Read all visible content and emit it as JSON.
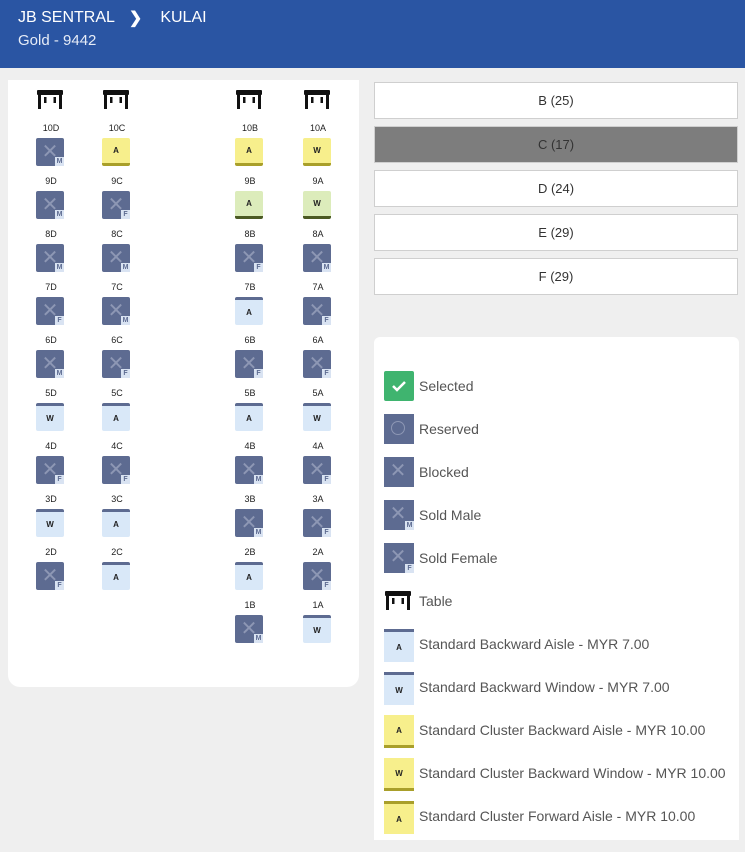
{
  "header": {
    "origin": "JB SENTRAL",
    "destination": "KULAI",
    "coach_info": "Gold - 9442"
  },
  "coaches": [
    {
      "label": "B (25)",
      "active": false
    },
    {
      "label": "C (17)",
      "active": true
    },
    {
      "label": "D (24)",
      "active": false
    },
    {
      "label": "E (29)",
      "active": false
    },
    {
      "label": "F (29)",
      "active": false
    }
  ],
  "seats": [
    {
      "id": "10D",
      "state": "blocked",
      "tag": "M"
    },
    {
      "id": "10C",
      "state": "cluster",
      "letter": "A"
    },
    {
      "id": "10B",
      "state": "cluster",
      "letter": "A"
    },
    {
      "id": "10A",
      "state": "cluster",
      "letter": "W"
    },
    {
      "id": "9D",
      "state": "blocked",
      "tag": "M"
    },
    {
      "id": "9C",
      "state": "blocked",
      "tag": "F"
    },
    {
      "id": "9B",
      "state": "forward",
      "letter": "A"
    },
    {
      "id": "9A",
      "state": "forward",
      "letter": "W"
    },
    {
      "id": "8D",
      "state": "blocked",
      "tag": "M"
    },
    {
      "id": "8C",
      "state": "blocked",
      "tag": "M"
    },
    {
      "id": "8B",
      "state": "blocked",
      "tag": "F"
    },
    {
      "id": "8A",
      "state": "blocked",
      "tag": "M"
    },
    {
      "id": "7D",
      "state": "blocked",
      "tag": "F"
    },
    {
      "id": "7C",
      "state": "blocked",
      "tag": "M"
    },
    {
      "id": "7B",
      "state": "standard",
      "letter": "A"
    },
    {
      "id": "7A",
      "state": "blocked",
      "tag": "F"
    },
    {
      "id": "6D",
      "state": "blocked",
      "tag": "M"
    },
    {
      "id": "6C",
      "state": "blocked",
      "tag": "F"
    },
    {
      "id": "6B",
      "state": "blocked",
      "tag": "F"
    },
    {
      "id": "6A",
      "state": "blocked",
      "tag": "F"
    },
    {
      "id": "5D",
      "state": "standard",
      "letter": "W"
    },
    {
      "id": "5C",
      "state": "standard",
      "letter": "A"
    },
    {
      "id": "5B",
      "state": "standard",
      "letter": "A"
    },
    {
      "id": "5A",
      "state": "standard",
      "letter": "W"
    },
    {
      "id": "4D",
      "state": "blocked",
      "tag": "F"
    },
    {
      "id": "4C",
      "state": "blocked",
      "tag": "F"
    },
    {
      "id": "4B",
      "state": "blocked",
      "tag": "M"
    },
    {
      "id": "4A",
      "state": "blocked",
      "tag": "F"
    },
    {
      "id": "3D",
      "state": "standard",
      "letter": "W"
    },
    {
      "id": "3C",
      "state": "standard",
      "letter": "A"
    },
    {
      "id": "3B",
      "state": "blocked",
      "tag": "M"
    },
    {
      "id": "3A",
      "state": "blocked",
      "tag": "F"
    },
    {
      "id": "2D",
      "state": "blocked",
      "tag": "F"
    },
    {
      "id": "2C",
      "state": "standard",
      "letter": "A"
    },
    {
      "id": "2B",
      "state": "standard",
      "letter": "A"
    },
    {
      "id": "2A",
      "state": "blocked",
      "tag": "F"
    },
    {
      "id": "1B",
      "state": "blocked",
      "tag": "M"
    },
    {
      "id": "1A",
      "state": "standard",
      "letter": "W"
    }
  ],
  "legend": {
    "selected": "Selected",
    "reserved": "Reserved",
    "blocked": "Blocked",
    "sold_male": "Sold Male",
    "sold_female": "Sold Female",
    "table": "Table",
    "std_back_aisle": "Standard Backward Aisle - MYR 7.00",
    "std_back_window": "Standard Backward Window - MYR 7.00",
    "clu_back_aisle": "Standard Cluster Backward Aisle - MYR 10.00",
    "clu_back_window": "Standard Cluster Backward Window - MYR 10.00",
    "clu_fwd_aisle": "Standard Cluster Forward Aisle - MYR 10.00",
    "seat_letters": {
      "aisle": "A",
      "window": "W",
      "male": "M",
      "female": "F"
    }
  },
  "colors": {
    "header": "#2a55a3",
    "blocked_seat": "#5d6b91",
    "standard_seat": "#d9e8f8",
    "cluster_seat": "#f7ef8c",
    "forward_seat": "#dcecbb",
    "selected": "#3fb46f",
    "active_coach": "#7d7d7d"
  }
}
